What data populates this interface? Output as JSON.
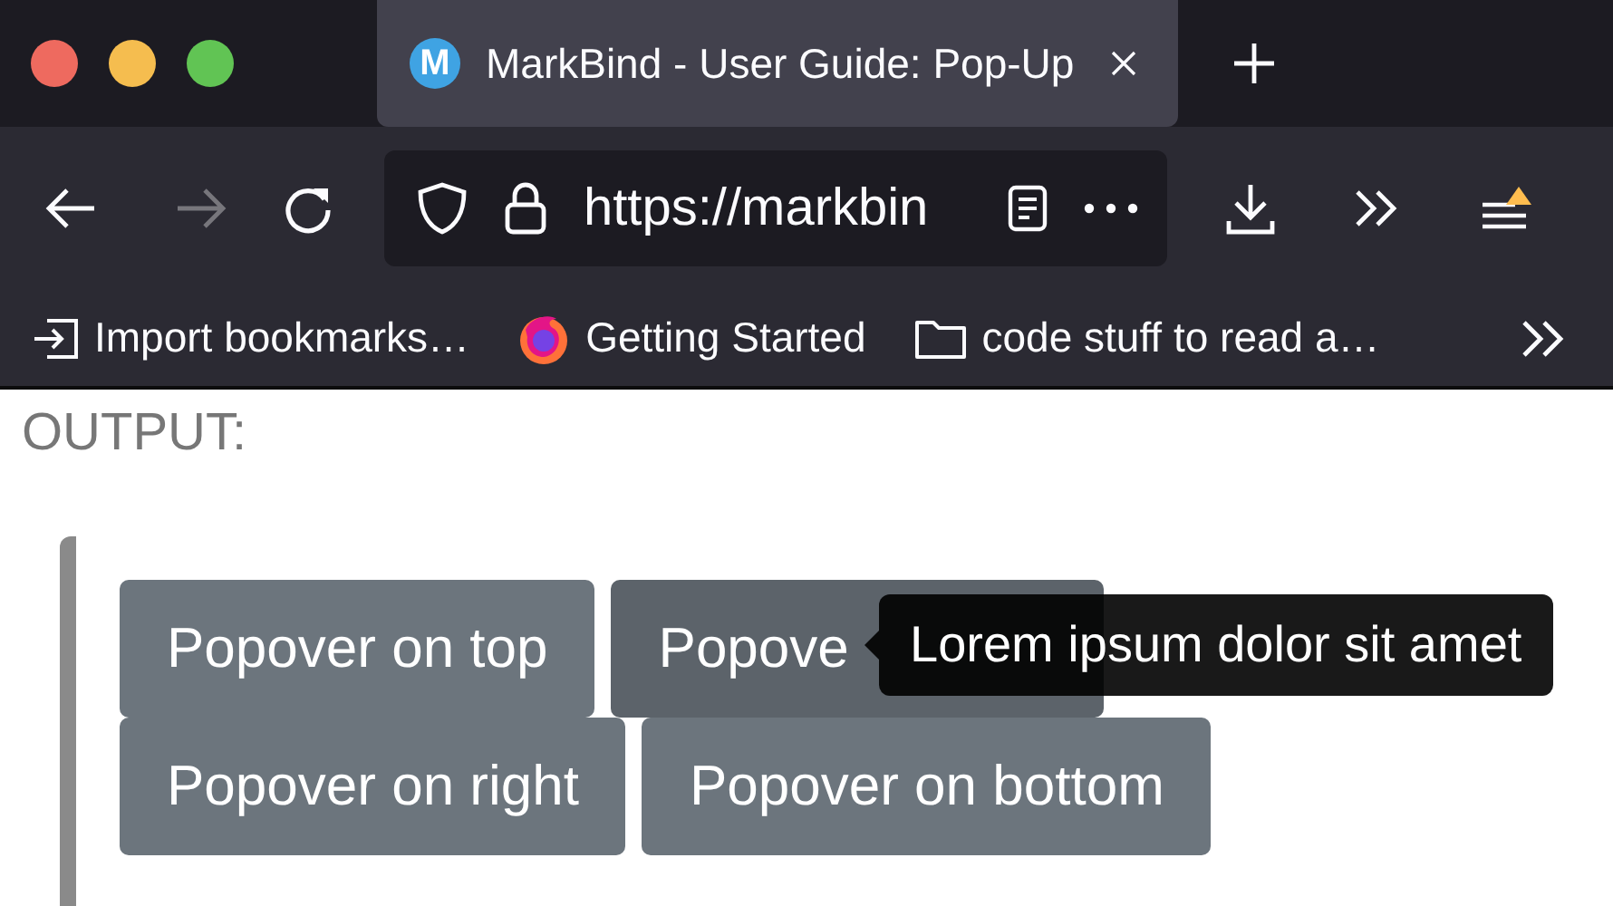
{
  "window_controls": [
    {
      "color": "#ee6a5f"
    },
    {
      "color": "#f5bd4f"
    },
    {
      "color": "#61c454"
    }
  ],
  "tabs": [
    {
      "favicon_letter": "M",
      "title": "MarkBind - User Guide: Pop-Up",
      "selected": true
    }
  ],
  "toolbar": {
    "forward_disabled": true,
    "url": "https://markbin",
    "menu_alert": true
  },
  "bookmarks": [
    {
      "kind": "import",
      "label": "Import bookmarks…"
    },
    {
      "kind": "firefox",
      "label": "Getting Started"
    },
    {
      "kind": "folder",
      "label": "code stuff to read a…"
    }
  ],
  "page": {
    "heading": "OUTPUT:",
    "buttons": [
      {
        "label": "Popover on top",
        "hovered": false
      },
      {
        "label": "Popove",
        "hovered": true
      },
      {
        "label": "Popover on right",
        "hovered": false
      },
      {
        "label": "Popover on bottom",
        "hovered": false
      }
    ],
    "tooltip": "Lorem ipsum dolor sit amet"
  }
}
